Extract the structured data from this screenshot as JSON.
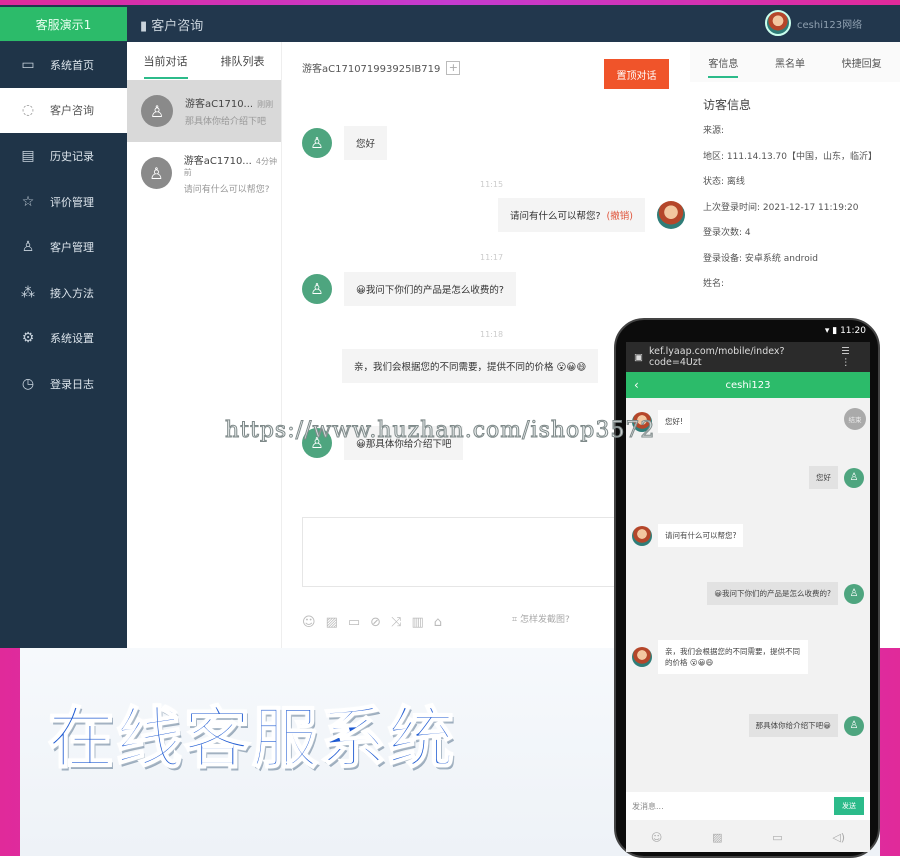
{
  "header": {
    "brand": "客服演示1",
    "breadcrumb": "客户咨询",
    "user": "ceshi123网络"
  },
  "sidebar": {
    "items": [
      {
        "label": "系统首页",
        "icon": "▭"
      },
      {
        "label": "客户咨询",
        "icon": "◌"
      },
      {
        "label": "历史记录",
        "icon": "▤"
      },
      {
        "label": "评价管理",
        "icon": "☆"
      },
      {
        "label": "客户管理",
        "icon": "♙"
      },
      {
        "label": "接入方法",
        "icon": "⁂"
      },
      {
        "label": "系统设置",
        "icon": "⚙"
      },
      {
        "label": "登录日志",
        "icon": "◷"
      }
    ]
  },
  "conversations": {
    "tabs": [
      "当前对话",
      "排队列表"
    ],
    "items": [
      {
        "name": "游客aC1710...",
        "time": "刚刚",
        "preview": "那具体你给介绍下吧"
      },
      {
        "name": "游客aC1710...",
        "time": "4分钟前",
        "preview": "请问有什么可以帮您?"
      }
    ]
  },
  "chat": {
    "visitor_id": "游客aC171071993925IB719",
    "end_button": "置顶对话",
    "messages": [
      {
        "from": "visitor",
        "text": "您好"
      },
      {
        "time": "11:15"
      },
      {
        "from": "agent",
        "text": "请问有什么可以帮您?",
        "recall": "(撤销)"
      },
      {
        "time": "11:17"
      },
      {
        "from": "visitor",
        "text": "😀我问下你们的产品是怎么收费的?"
      },
      {
        "time": "11:18"
      },
      {
        "from": "agent",
        "text": "亲，我们会根据您的不同需要，提供不同的价格 😮😀😄"
      },
      {
        "from": "visitor",
        "text": "😀那具体你给介绍下吧"
      }
    ],
    "tools": [
      "☺",
      "▨",
      "▭",
      "⊘",
      "⤨",
      "▥",
      "⌂"
    ],
    "screenshot_hint": "怎样发截图?"
  },
  "right_panel": {
    "tabs": [
      "客信息",
      "黑名单",
      "快捷回复"
    ],
    "title": "访客信息",
    "fields": [
      "来源:",
      "地区: 111.14.13.70【中国，山东，临沂】",
      "状态: 离线",
      "上次登录时间: 2021-12-17 11:19:20",
      "登录次数: 4",
      "登录设备: 安卓系统 android",
      "姓名:"
    ]
  },
  "slogan": "在线客服系统",
  "watermark": "https://www.huzhan.com/ishop3572",
  "mobile": {
    "status_time": "11:20",
    "url": "kef.lyaap.com/mobile/index?code=4Uzt",
    "title": "ceshi123",
    "end_chat": "结束",
    "messages": [
      {
        "from": "agent",
        "text": "您好!"
      },
      {
        "from": "visitor",
        "text": "您好"
      },
      {
        "from": "agent",
        "text": "请问有什么可以帮您?"
      },
      {
        "from": "visitor",
        "text": "😀我问下你们的产品是怎么收费的?"
      },
      {
        "from": "agent",
        "text": "亲，我们会根据您的不同需要，提供不同的价格 😮😀😄"
      },
      {
        "from": "visitor",
        "text": "那具体你给介绍下吧😀"
      }
    ],
    "input_placeholder": "发消息...",
    "send": "发送"
  },
  "colors": {
    "sidebar": "#1f3448",
    "accent": "#2cbb6a",
    "danger": "#f0542a",
    "slogan": "#1e5ad2"
  }
}
